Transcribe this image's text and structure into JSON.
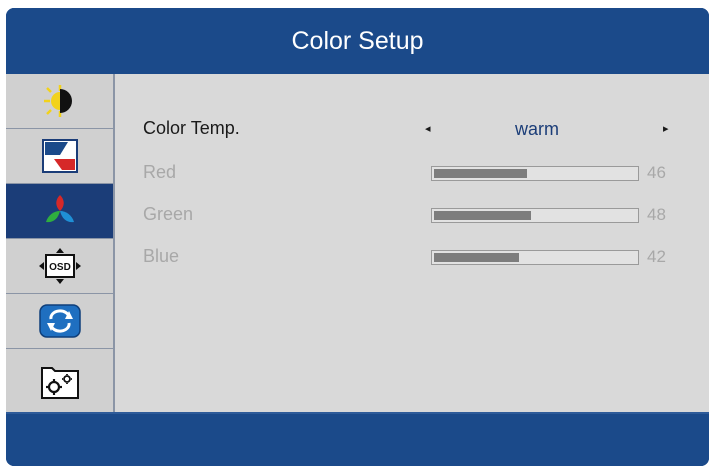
{
  "title": "Color Setup",
  "sidebar": {
    "items": [
      {
        "icon": "brightness-contrast-icon",
        "selected": false
      },
      {
        "icon": "image-setup-icon",
        "selected": false
      },
      {
        "icon": "color-setup-icon",
        "selected": true
      },
      {
        "icon": "osd-setup-icon",
        "selected": false
      },
      {
        "icon": "reset-icon",
        "selected": false
      },
      {
        "icon": "extra-settings-icon",
        "selected": false
      }
    ]
  },
  "osd_icon_text": "OSD",
  "color_temp": {
    "label": "Color Temp.",
    "value": "warm",
    "left_arrow": "◂",
    "right_arrow": "▸"
  },
  "channels": [
    {
      "label": "Red",
      "value": 46,
      "display": "46"
    },
    {
      "label": "Green",
      "value": 48,
      "display": "48"
    },
    {
      "label": "Blue",
      "value": 42,
      "display": "42"
    }
  ],
  "colors": {
    "frame_blue": "#1b4a8a",
    "selected_blue": "#1b3d78",
    "panel_gray": "#d9d9d9",
    "bar_fill": "#7d7d7d",
    "disabled_text": "#a8a8a8"
  }
}
